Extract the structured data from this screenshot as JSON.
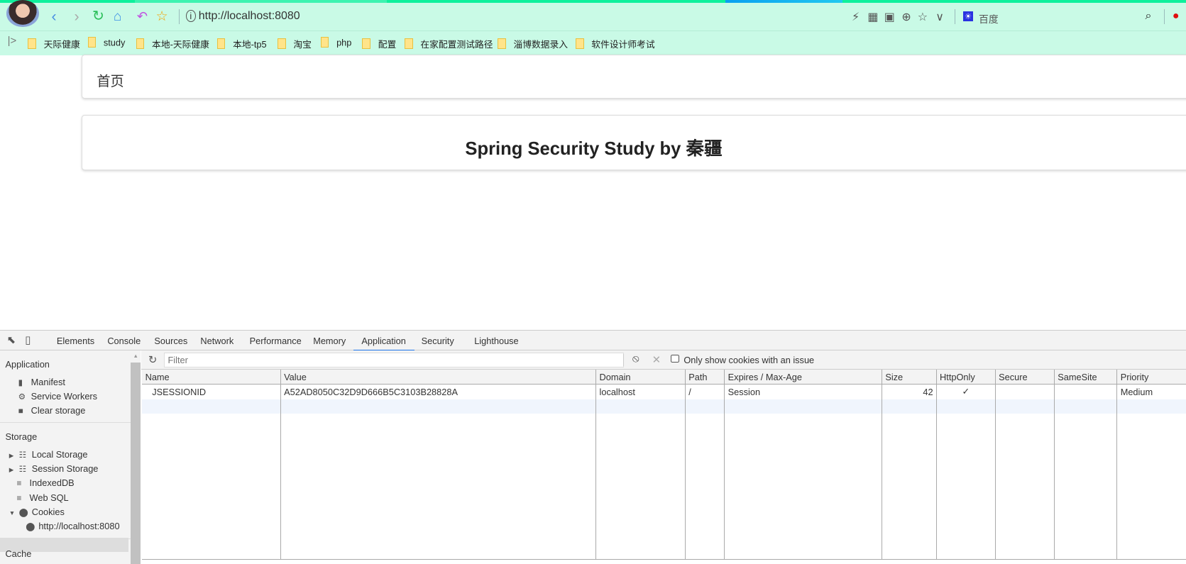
{
  "browser": {
    "url": "http://localhost:8080",
    "search_engine": "百度"
  },
  "bookmarks": [
    "天际健康",
    "study",
    "本地-天际健康",
    "本地-tp5",
    "淘宝",
    "php",
    "配置",
    "在家配置测试路径",
    "淄博数据录入",
    "软件设计师考试"
  ],
  "page": {
    "breadcrumb": "首页",
    "title": "Spring Security Study by 秦疆"
  },
  "devtools": {
    "tabs": [
      "Elements",
      "Console",
      "Sources",
      "Network",
      "Performance",
      "Memory",
      "Application",
      "Security",
      "Lighthouse"
    ],
    "active_tab": "Application",
    "sidebar": {
      "application_header": "Application",
      "application_items": [
        "Manifest",
        "Service Workers",
        "Clear storage"
      ],
      "storage_header": "Storage",
      "storage_items": [
        "Local Storage",
        "Session Storage",
        "IndexedDB",
        "Web SQL",
        "Cookies"
      ],
      "cookie_origin": "http://localhost:8080",
      "cache_header": "Cache"
    },
    "filter_placeholder": "Filter",
    "only_issues_label": "Only show cookies with an issue",
    "columns": [
      "Name",
      "Value",
      "Domain",
      "Path",
      "Expires / Max-Age",
      "Size",
      "HttpOnly",
      "Secure",
      "SameSite",
      "Priority"
    ],
    "rows": [
      [
        "JSESSIONID",
        "A52AD8050C32D9D666B5C3103B28828A",
        "localhost",
        "/",
        "Session",
        "42",
        "✓",
        "",
        "",
        "Medium"
      ]
    ]
  }
}
